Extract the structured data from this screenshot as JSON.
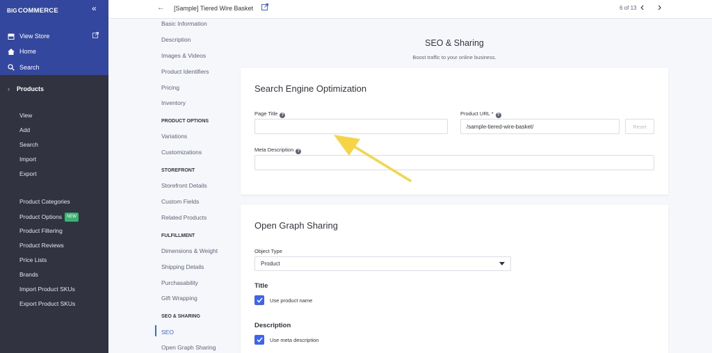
{
  "sidebar": {
    "logo_prefix": "BIG",
    "logo_text": "COMMERCE",
    "collapse_icon": "«",
    "top_links": [
      {
        "label": "View Store",
        "icon": "store-icon"
      },
      {
        "label": "Home",
        "icon": "home-icon"
      },
      {
        "label": "Search",
        "icon": "search-icon"
      }
    ],
    "section_title": "Products",
    "group1": [
      "View",
      "Add",
      "Search",
      "Import",
      "Export"
    ],
    "group2": [
      "Product Categories",
      "Product Options",
      "Product Filtering",
      "Product Reviews",
      "Price Lists",
      "Brands",
      "Import Product SKUs",
      "Export Product SKUs"
    ],
    "new_badge": "NEW"
  },
  "topbar": {
    "product_title": "[Sample] Tiered Wire Basket",
    "pager": "6 of 13"
  },
  "section_nav": {
    "items_top": [
      "Basic Information",
      "Description",
      "Images & Videos",
      "Product Identifiers",
      "Pricing",
      "Inventory"
    ],
    "head_options": "PRODUCT OPTIONS",
    "items_options": [
      "Variations",
      "Customizations"
    ],
    "head_storefront": "STOREFRONT",
    "items_storefront": [
      "Storefront Details",
      "Custom Fields",
      "Related Products"
    ],
    "head_fulfillment": "FULFILLMENT",
    "items_fulfillment": [
      "Dimensions & Weight",
      "Shipping Details",
      "Purchasability",
      "Gift Wrapping"
    ],
    "head_seo": "SEO & SHARING",
    "items_seo": [
      "SEO",
      "Open Graph Sharing"
    ]
  },
  "main": {
    "title": "SEO & Sharing",
    "subtitle": "Boost traffic to your online business.",
    "seo_card": {
      "title": "Search Engine Optimization",
      "page_title_label": "Page Title",
      "page_title_value": "",
      "product_url_label": "Product URL *",
      "product_url_value": "/sample-tiered-wire-basket/",
      "reset_label": "Reset",
      "meta_desc_label": "Meta Description",
      "meta_desc_value": ""
    },
    "og_card": {
      "title": "Open Graph Sharing",
      "object_type_label": "Object Type",
      "object_type_value": "Product",
      "title_label": "Title",
      "use_product_name": "Use product name",
      "description_label": "Description",
      "use_meta_desc": "Use meta description"
    }
  },
  "colors": {
    "accent": "#3c64f4",
    "sidebar": "#313440",
    "sidebar_top": "#34479f",
    "annotation_arrow": "#f5d547"
  }
}
